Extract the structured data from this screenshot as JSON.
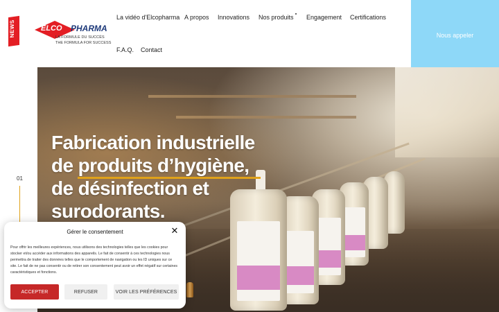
{
  "news_badge": {
    "label": "NEWS"
  },
  "logo": {
    "elco": "ELCO",
    "pharma": "PHARMA",
    "tagline_fr": "LA FORMULE DU SUCCÈS",
    "tagline_en": "THE FORMULA FOR SUCCESS"
  },
  "nav": {
    "items": [
      {
        "label": "La vidéo d'Elcopharma"
      },
      {
        "label": "A propos"
      },
      {
        "label": "Innovations"
      },
      {
        "label": "Nos produits"
      },
      {
        "label": "Engagement"
      },
      {
        "label": "Certifications"
      },
      {
        "label": "F.A.Q."
      },
      {
        "label": "Contact"
      }
    ],
    "call_button": "Nous appeler"
  },
  "hero": {
    "title_lines": [
      "Fabrication industrielle",
      "de produits d’hygiène,",
      "de désinfection et",
      "surodorants."
    ],
    "slide_index": "01",
    "accent_color": "#e0a21a"
  },
  "cookie": {
    "title": "Gérer le consentement",
    "body": "Pour offrir les meilleures expériences, nous utilisons des technologies telles que les cookies pour stocker et/ou accéder aux informations des appareils. Le fait de consentir à ces technologies nous permettra de traiter des données telles que le comportement de navigation ou les ID uniques sur ce site. Le fait de ne pas consentir ou de retirer son consentement peut avoir un effet négatif sur certaines caractéristiques et fonctions.",
    "accept": "ACCEPTER",
    "refuse": "REFUSER",
    "preferences": "VOIR LES PRÉFÉRENCES",
    "accept_color": "#c62828"
  },
  "colors": {
    "call_button_bg": "#8ed8f8",
    "brand_red": "#e31e24",
    "brand_blue": "#1e3a7a"
  },
  "icons": {
    "close": "close-icon"
  }
}
